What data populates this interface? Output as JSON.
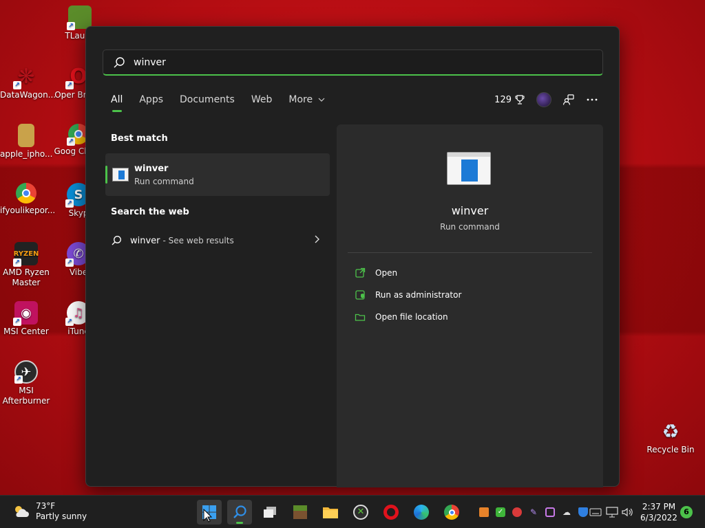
{
  "desktop": {
    "icons": [
      {
        "label": "TLaunc",
        "glyph": "■",
        "color": "#5b8c2a"
      },
      {
        "label": "DataWagon...",
        "glyph": "❋",
        "color": "#b4121a"
      },
      {
        "label": "Oper Brows",
        "glyph": "O",
        "color": "#e0121c"
      },
      {
        "label": "apple_ipho...",
        "glyph": "▮",
        "color": "#c9a24a"
      },
      {
        "label": "Goog Chron",
        "glyph": "●",
        "color": "#3b82f6"
      },
      {
        "label": "ifyoulikepor...",
        "glyph": "●",
        "color": "#3b82f6"
      },
      {
        "label": "Skyp",
        "glyph": "S",
        "color": "#0a8fd8"
      },
      {
        "label": "AMD Ryzen Master",
        "glyph": "R",
        "color": "#222222"
      },
      {
        "label": "Vibe",
        "glyph": "✆",
        "color": "#7d4bd6"
      },
      {
        "label": "MSI Center",
        "glyph": "◉",
        "color": "#c0125f"
      },
      {
        "label": "iTune",
        "glyph": "♫",
        "color": "#e84a8a"
      },
      {
        "label": "MSI Afterburner",
        "glyph": "✈",
        "color": "#2a2a2a"
      },
      {
        "label": "Recycle Bin",
        "glyph": "♻",
        "color": "#8fb5d6"
      }
    ]
  },
  "search": {
    "query": "winver",
    "tabs": [
      {
        "label": "All"
      },
      {
        "label": "Apps"
      },
      {
        "label": "Documents"
      },
      {
        "label": "Web"
      },
      {
        "label": "More"
      }
    ],
    "points": "129",
    "best_match_heading": "Best match",
    "best_match": {
      "name": "winver",
      "type": "Run command"
    },
    "web_heading": "Search the web",
    "web_result": {
      "query": "winver",
      "hint": "- See web results"
    }
  },
  "details": {
    "title": "winver",
    "subtitle": "Run command",
    "actions": [
      {
        "label": "Open"
      },
      {
        "label": "Run as administrator"
      },
      {
        "label": "Open file location"
      }
    ]
  },
  "taskbar": {
    "weather": {
      "temp": "73°F",
      "desc": "Partly sunny"
    },
    "time": "2:37 PM",
    "date": "6/3/2022",
    "notification_count": "6"
  },
  "colors": {
    "accent": "#4cc24a",
    "panel": "#202020",
    "wallpaper": "#b00f14"
  }
}
